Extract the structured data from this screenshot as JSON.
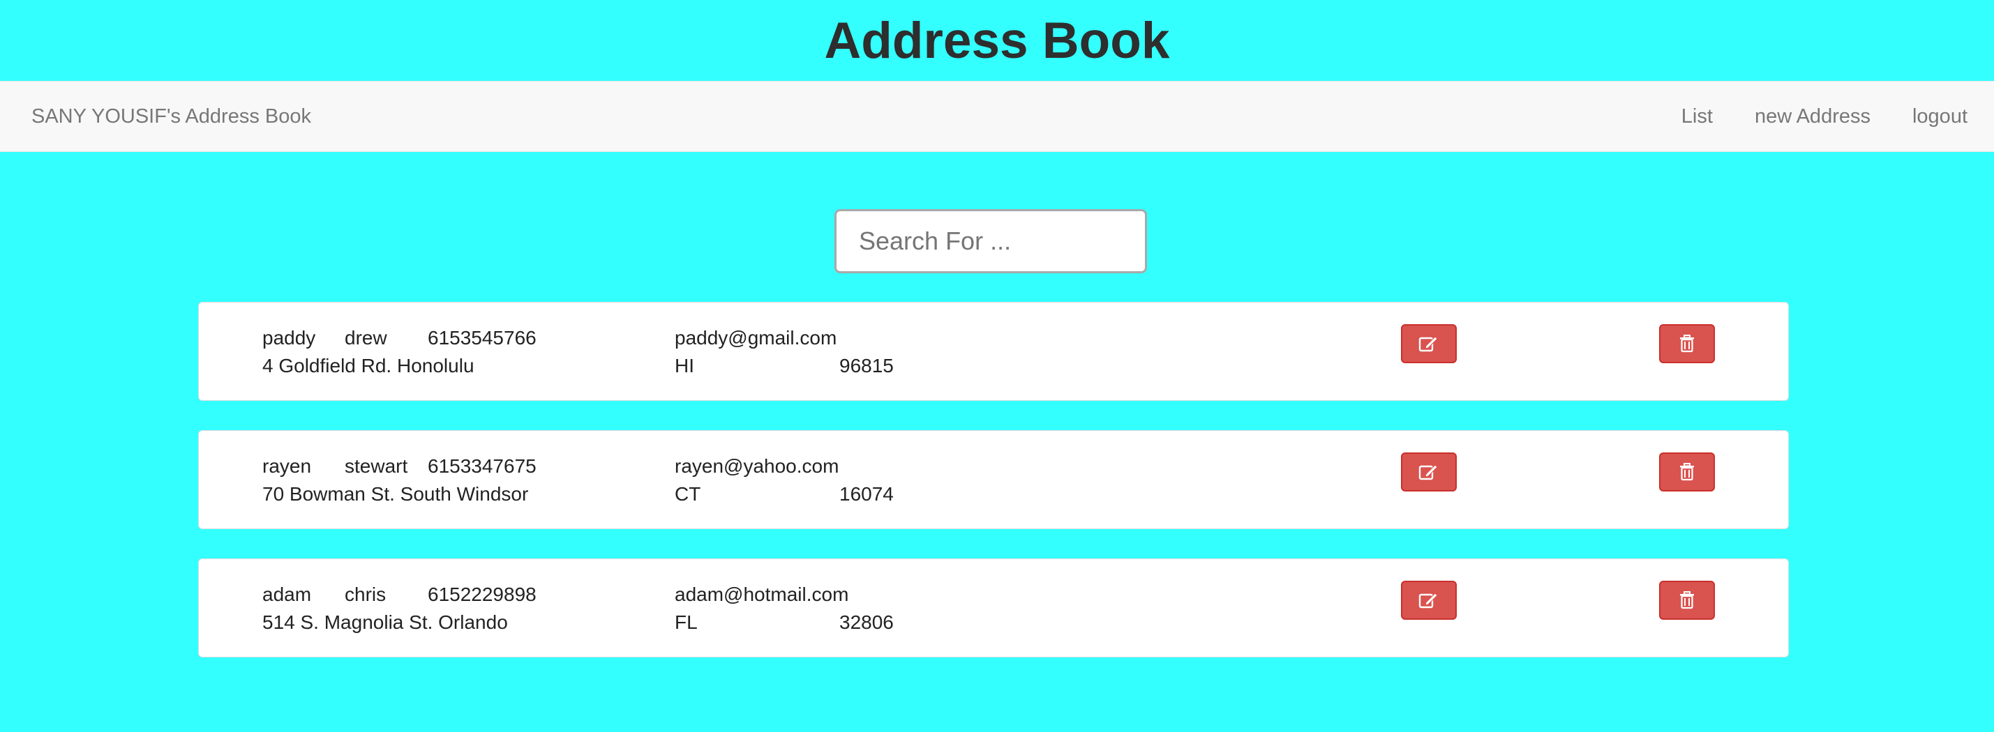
{
  "header": {
    "title": "Address Book"
  },
  "navbar": {
    "brand": "SANY YOUSIF's Address Book",
    "links": [
      "List",
      "new Address",
      "logout"
    ]
  },
  "search": {
    "placeholder": "Search For ...",
    "value": ""
  },
  "contacts": [
    {
      "first": "paddy",
      "last": "drew",
      "phone": "6153545766",
      "email": "paddy@gmail.com",
      "street_city": "4 Goldfield Rd. Honolulu",
      "state": "HI",
      "zip": "96815"
    },
    {
      "first": "rayen",
      "last": "stewart",
      "phone": "6153347675",
      "email": "rayen@yahoo.com",
      "street_city": "70 Bowman St. South Windsor",
      "state": "CT",
      "zip": "16074"
    },
    {
      "first": "adam",
      "last": "chris",
      "phone": "6152229898",
      "email": "adam@hotmail.com",
      "street_city": "514 S. Magnolia St. Orlando",
      "state": "FL",
      "zip": "32806"
    }
  ],
  "icons": {
    "edit": "edit-icon",
    "delete": "trash-icon"
  },
  "colors": {
    "background": "#33ffff",
    "navbar": "#f8f8f8",
    "button_danger": "#d9534f"
  }
}
